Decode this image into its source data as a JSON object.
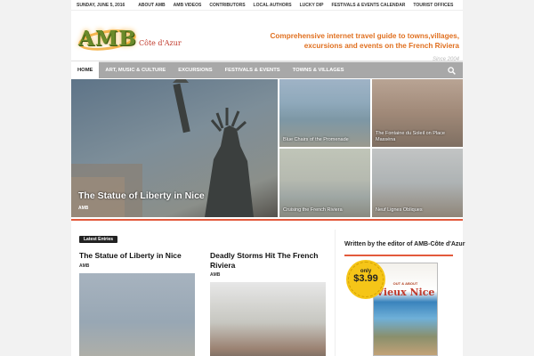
{
  "topbar": {
    "date": "SUNDAY, JUNE 5, 2016",
    "links": [
      "ABOUT AMB",
      "AMB VIDEOS",
      "CONTRIBUTORS",
      "LOCAL AUTHORS",
      "LUCKY DIP",
      "FESTIVALS & EVENTS CALENDAR",
      "TOURIST OFFICES"
    ]
  },
  "header": {
    "logo_text": "AMB",
    "logo_sub": "Côte d'Azur",
    "tagline_line1": "Comprehensive internet travel guide to towns,villages,",
    "tagline_line2": "excursions and events on the French Riviera",
    "since": "Since 2004"
  },
  "nav": {
    "items": [
      "HOME",
      "ART, MUSIC & CULTURE",
      "EXCURSIONS",
      "FESTIVALS & EVENTS",
      "TOWNS & VILLAGES"
    ],
    "active": "HOME",
    "search_icon": "search-icon"
  },
  "featured": {
    "main": {
      "title": "The Statue of Liberty in Nice",
      "author": "AMB"
    },
    "tiles": [
      {
        "title": "Blue Chairs of the Promenade"
      },
      {
        "title": "The Fontaine du Soleil on Place Masséna"
      },
      {
        "title": "Cruising the French Riviera"
      },
      {
        "title": "Neuf Lignes Obliques"
      }
    ]
  },
  "latest": {
    "label": "Latest Entries",
    "posts": [
      {
        "title": "The Statue of Liberty in Nice",
        "author": "AMB"
      },
      {
        "title": "Deadly Storms Hit The French Riviera",
        "author": "AMB"
      }
    ]
  },
  "sidebar": {
    "title": "Written by the editor of AMB-Côte d'Azur",
    "book_top": "OUT & ABOUT",
    "book_title": "Vieux Nice",
    "badge_only": "only",
    "badge_price": "$3.99"
  },
  "colors": {
    "accent": "#e35a3c",
    "nav_bg": "#a8a8a8",
    "tagline": "#e07020"
  }
}
